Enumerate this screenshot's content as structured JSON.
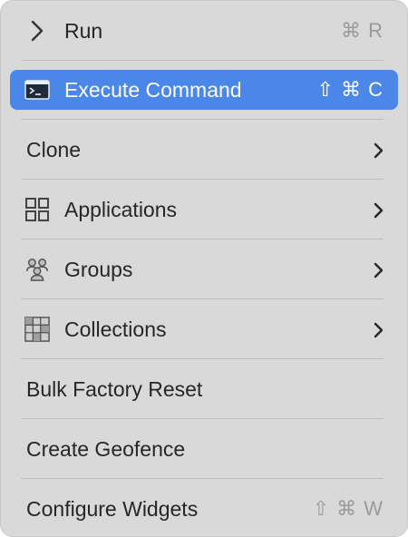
{
  "menu": {
    "items": [
      {
        "label": "Run",
        "shortcut": "⌘ R",
        "icon": "chevron-right-icon"
      },
      {
        "label": "Execute Command",
        "shortcut": "⇧ ⌘ C",
        "icon": "terminal-icon",
        "highlighted": true
      },
      {
        "label": "Clone",
        "submenu": true
      },
      {
        "label": "Applications",
        "icon": "apps-grid-icon",
        "submenu": true
      },
      {
        "label": "Groups",
        "icon": "groups-icon",
        "submenu": true
      },
      {
        "label": "Collections",
        "icon": "collections-icon",
        "submenu": true
      },
      {
        "label": "Bulk Factory Reset"
      },
      {
        "label": "Create Geofence"
      },
      {
        "label": "Configure Widgets",
        "shortcut": "⇧ ⌘ W"
      }
    ]
  },
  "colors": {
    "menu_background": "#d9d9d9",
    "highlight": "#4a87e8",
    "text": "#262626",
    "shortcut_text": "#9a9a9a",
    "separator": "#bdbdbd"
  }
}
